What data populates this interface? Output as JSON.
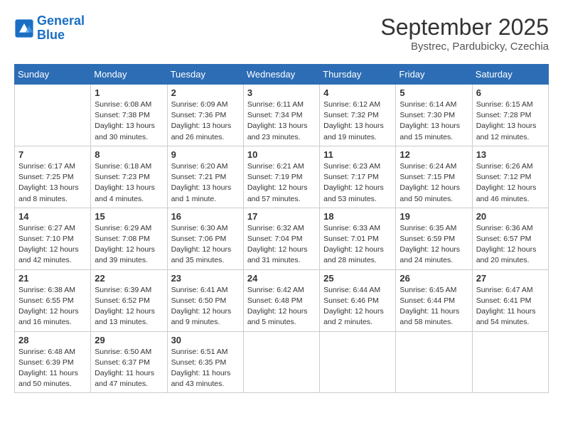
{
  "header": {
    "logo_line1": "General",
    "logo_line2": "Blue",
    "month": "September 2025",
    "location": "Bystrec, Pardubicky, Czechia"
  },
  "weekdays": [
    "Sunday",
    "Monday",
    "Tuesday",
    "Wednesday",
    "Thursday",
    "Friday",
    "Saturday"
  ],
  "weeks": [
    [
      {
        "day": "",
        "info": ""
      },
      {
        "day": "1",
        "info": "Sunrise: 6:08 AM\nSunset: 7:38 PM\nDaylight: 13 hours\nand 30 minutes."
      },
      {
        "day": "2",
        "info": "Sunrise: 6:09 AM\nSunset: 7:36 PM\nDaylight: 13 hours\nand 26 minutes."
      },
      {
        "day": "3",
        "info": "Sunrise: 6:11 AM\nSunset: 7:34 PM\nDaylight: 13 hours\nand 23 minutes."
      },
      {
        "day": "4",
        "info": "Sunrise: 6:12 AM\nSunset: 7:32 PM\nDaylight: 13 hours\nand 19 minutes."
      },
      {
        "day": "5",
        "info": "Sunrise: 6:14 AM\nSunset: 7:30 PM\nDaylight: 13 hours\nand 15 minutes."
      },
      {
        "day": "6",
        "info": "Sunrise: 6:15 AM\nSunset: 7:28 PM\nDaylight: 13 hours\nand 12 minutes."
      }
    ],
    [
      {
        "day": "7",
        "info": "Sunrise: 6:17 AM\nSunset: 7:25 PM\nDaylight: 13 hours\nand 8 minutes."
      },
      {
        "day": "8",
        "info": "Sunrise: 6:18 AM\nSunset: 7:23 PM\nDaylight: 13 hours\nand 4 minutes."
      },
      {
        "day": "9",
        "info": "Sunrise: 6:20 AM\nSunset: 7:21 PM\nDaylight: 13 hours\nand 1 minute."
      },
      {
        "day": "10",
        "info": "Sunrise: 6:21 AM\nSunset: 7:19 PM\nDaylight: 12 hours\nand 57 minutes."
      },
      {
        "day": "11",
        "info": "Sunrise: 6:23 AM\nSunset: 7:17 PM\nDaylight: 12 hours\nand 53 minutes."
      },
      {
        "day": "12",
        "info": "Sunrise: 6:24 AM\nSunset: 7:15 PM\nDaylight: 12 hours\nand 50 minutes."
      },
      {
        "day": "13",
        "info": "Sunrise: 6:26 AM\nSunset: 7:12 PM\nDaylight: 12 hours\nand 46 minutes."
      }
    ],
    [
      {
        "day": "14",
        "info": "Sunrise: 6:27 AM\nSunset: 7:10 PM\nDaylight: 12 hours\nand 42 minutes."
      },
      {
        "day": "15",
        "info": "Sunrise: 6:29 AM\nSunset: 7:08 PM\nDaylight: 12 hours\nand 39 minutes."
      },
      {
        "day": "16",
        "info": "Sunrise: 6:30 AM\nSunset: 7:06 PM\nDaylight: 12 hours\nand 35 minutes."
      },
      {
        "day": "17",
        "info": "Sunrise: 6:32 AM\nSunset: 7:04 PM\nDaylight: 12 hours\nand 31 minutes."
      },
      {
        "day": "18",
        "info": "Sunrise: 6:33 AM\nSunset: 7:01 PM\nDaylight: 12 hours\nand 28 minutes."
      },
      {
        "day": "19",
        "info": "Sunrise: 6:35 AM\nSunset: 6:59 PM\nDaylight: 12 hours\nand 24 minutes."
      },
      {
        "day": "20",
        "info": "Sunrise: 6:36 AM\nSunset: 6:57 PM\nDaylight: 12 hours\nand 20 minutes."
      }
    ],
    [
      {
        "day": "21",
        "info": "Sunrise: 6:38 AM\nSunset: 6:55 PM\nDaylight: 12 hours\nand 16 minutes."
      },
      {
        "day": "22",
        "info": "Sunrise: 6:39 AM\nSunset: 6:52 PM\nDaylight: 12 hours\nand 13 minutes."
      },
      {
        "day": "23",
        "info": "Sunrise: 6:41 AM\nSunset: 6:50 PM\nDaylight: 12 hours\nand 9 minutes."
      },
      {
        "day": "24",
        "info": "Sunrise: 6:42 AM\nSunset: 6:48 PM\nDaylight: 12 hours\nand 5 minutes."
      },
      {
        "day": "25",
        "info": "Sunrise: 6:44 AM\nSunset: 6:46 PM\nDaylight: 12 hours\nand 2 minutes."
      },
      {
        "day": "26",
        "info": "Sunrise: 6:45 AM\nSunset: 6:44 PM\nDaylight: 11 hours\nand 58 minutes."
      },
      {
        "day": "27",
        "info": "Sunrise: 6:47 AM\nSunset: 6:41 PM\nDaylight: 11 hours\nand 54 minutes."
      }
    ],
    [
      {
        "day": "28",
        "info": "Sunrise: 6:48 AM\nSunset: 6:39 PM\nDaylight: 11 hours\nand 50 minutes."
      },
      {
        "day": "29",
        "info": "Sunrise: 6:50 AM\nSunset: 6:37 PM\nDaylight: 11 hours\nand 47 minutes."
      },
      {
        "day": "30",
        "info": "Sunrise: 6:51 AM\nSunset: 6:35 PM\nDaylight: 11 hours\nand 43 minutes."
      },
      {
        "day": "",
        "info": ""
      },
      {
        "day": "",
        "info": ""
      },
      {
        "day": "",
        "info": ""
      },
      {
        "day": "",
        "info": ""
      }
    ]
  ]
}
